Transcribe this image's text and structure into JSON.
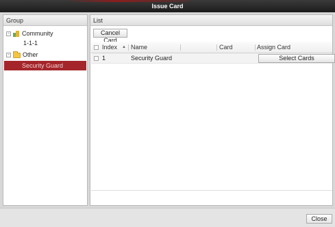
{
  "window": {
    "title": "Issue Card",
    "accent_color": "#8a1e1e"
  },
  "group_panel": {
    "header": "Group",
    "tree": [
      {
        "label": "Community",
        "expander": "-",
        "icon": "building-icon"
      },
      {
        "label": "1-1-1"
      },
      {
        "label": "Other",
        "expander": "-",
        "icon": "folder-icon"
      },
      {
        "label": "Security Guard",
        "selected": true
      }
    ],
    "selection_color": "#a4262b"
  },
  "list_panel": {
    "header": "List",
    "toolbar": {
      "cancel_card_label": "Cancel Card"
    },
    "table": {
      "columns": [
        "Index",
        "Name",
        "Card",
        "Assign Card"
      ],
      "rows": [
        {
          "index": "1",
          "name": "Security Guard",
          "card": "",
          "assign_card_label": "Select Cards"
        }
      ]
    }
  },
  "footer": {
    "close_label": "Close"
  }
}
